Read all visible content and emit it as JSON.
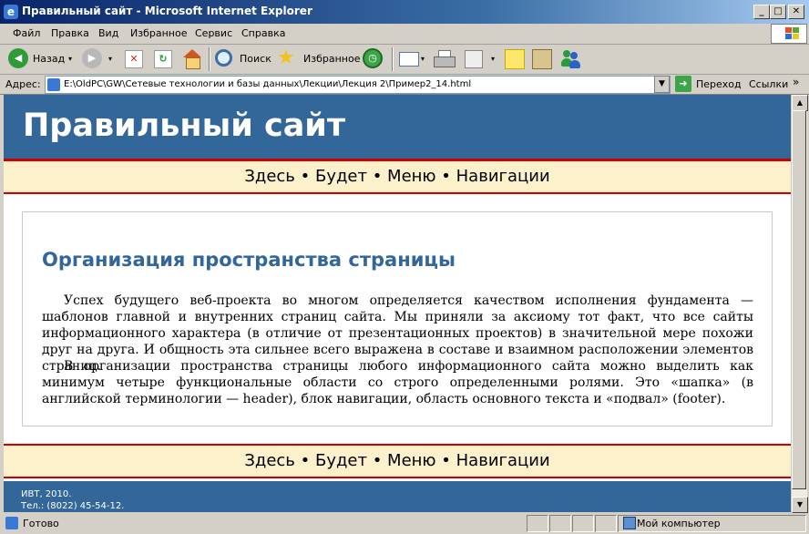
{
  "window": {
    "title": "Правильный сайт - Microsoft Internet Explorer"
  },
  "menu": [
    "Файл",
    "Правка",
    "Вид",
    "Избранное",
    "Сервис",
    "Справка"
  ],
  "toolbar": {
    "back": "Назад",
    "search": "Поиск",
    "favorites": "Избранное"
  },
  "address": {
    "label": "Адрес:",
    "url": "E:\\OldPC\\GW\\Сетевые технологии и базы данных\\Лекции\\Лекция 2\\Пример2_14.html",
    "go": "Переход",
    "links": "Ссылки"
  },
  "page": {
    "site_title": "Правильный сайт",
    "nav": [
      "Здесь",
      "Будет",
      "Меню",
      "Навигации"
    ],
    "heading": "Организация пространства страницы",
    "paragraphs": [
      "Успех будущего веб-проекта во многом определяется качеством исполнения фундамента — шаблонов главной и внутренних страниц сайта. Мы приняли за аксиому тот факт, что все сайты информационного характера (в отличие от презентационных проектов) в значительной мере похожи друг на друга. И общность эта сильнее всего выражена в составе и взаимном расположении элементов страниц.",
      "В организации пространства страницы любого информационного сайта можно выделить как минимум четыре функциональные области со строго определенными ролями. Это «шапка» (в английской терминологии — header), блок навигации, область основного текста и «подвал» (footer)."
    ],
    "footer_line1": "ИВТ, 2010.",
    "footer_line2": "Тел.: (8022) 45-54-12."
  },
  "status": {
    "text": "Готово",
    "zone": "Мой компьютер"
  },
  "colors": {
    "header_bg": "#336699",
    "accent_red": "#cc0000",
    "nav_bg": "#fdf1cc",
    "heading": "#336699"
  },
  "icons": [
    "ie-icon",
    "back-icon",
    "forward-icon",
    "stop-icon",
    "refresh-icon",
    "home-icon",
    "search-icon",
    "favorites-icon",
    "history-icon",
    "mail-icon",
    "print-icon",
    "edit-icon",
    "messenger-icon",
    "go-icon",
    "computer-icon"
  ]
}
